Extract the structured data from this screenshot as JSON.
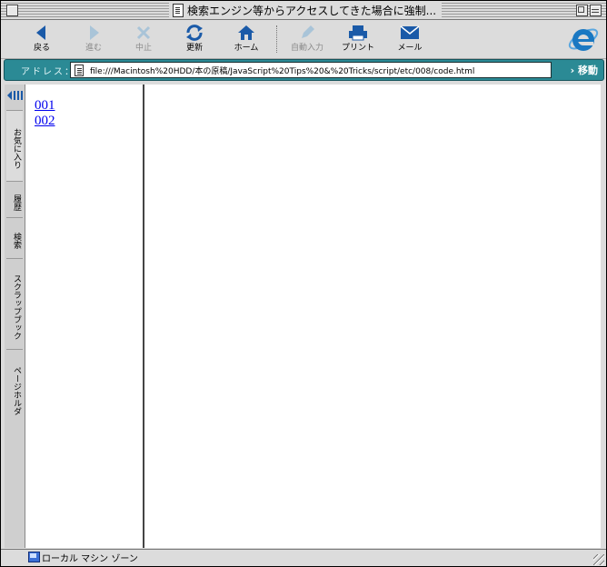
{
  "window": {
    "title": "検索エンジン等からアクセスしてきた場合に強制..."
  },
  "toolbar": {
    "buttons": [
      {
        "label": "戻る",
        "icon": "back-arrow-icon",
        "enabled": true
      },
      {
        "label": "進む",
        "icon": "forward-arrow-icon",
        "enabled": false
      },
      {
        "label": "中止",
        "icon": "stop-x-icon",
        "enabled": false
      },
      {
        "label": "更新",
        "icon": "refresh-icon",
        "enabled": true
      },
      {
        "label": "ホーム",
        "icon": "home-icon",
        "enabled": true
      },
      {
        "label": "自動入力",
        "icon": "autofill-pen-icon",
        "enabled": false
      },
      {
        "label": "プリント",
        "icon": "printer-icon",
        "enabled": true
      },
      {
        "label": "メール",
        "icon": "mail-icon",
        "enabled": true
      }
    ]
  },
  "address": {
    "label": "アドレス：",
    "url": "file:///Macintosh%20HDD/本の原稿/JavaScript%20Tips%20&%20Tricks/script/etc/008/code.html",
    "go_label": "› 移動"
  },
  "explorer_tabs": [
    {
      "label": "お気に入り"
    },
    {
      "label": "履歴"
    },
    {
      "label": "検索"
    },
    {
      "label": "スクラップブック"
    },
    {
      "label": "ページホルダ"
    }
  ],
  "left_frame": {
    "links": [
      "001",
      "002"
    ]
  },
  "status": {
    "zone_text": "ローカル マシン ゾーン"
  },
  "colors": {
    "address_bar": "#2b8a95",
    "link": "#0000ee",
    "toolbar_icon": "#1a5aa8"
  }
}
